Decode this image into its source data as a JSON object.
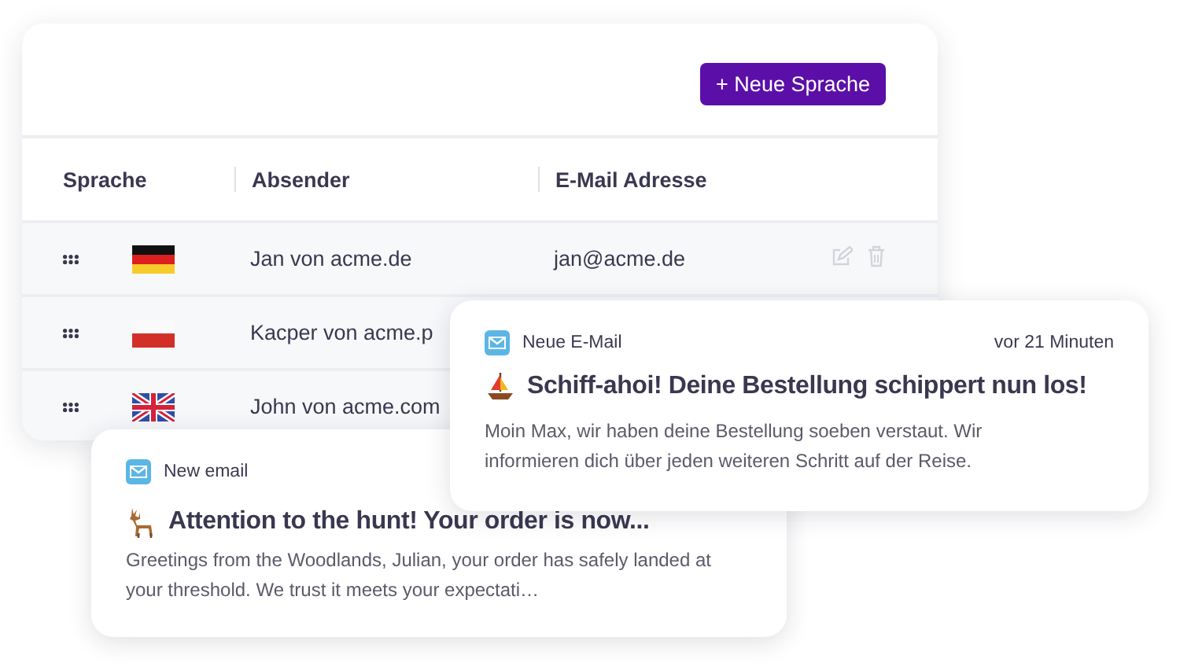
{
  "button": {
    "label": "+ Neue Sprache"
  },
  "table": {
    "columns": [
      "Sprache",
      "Absender",
      "E-Mail Adresse"
    ],
    "rows": [
      {
        "kind": "de",
        "sender": "Jan von acme.de",
        "email": "jan@acme.de"
      },
      {
        "kind": "pl",
        "sender": "Kacper von acme.p"
      },
      {
        "kind": "gb",
        "sender": "John von acme.com"
      }
    ]
  },
  "notifications": [
    {
      "app": "Neue E-Mail",
      "time": "vor 21 Minuten",
      "kind": "boat",
      "title": "Schiff-ahoi! Deine Bestellung schippert nun los!",
      "body": "Moin Max, wir haben deine Bestellung soeben verstaut. Wir informieren dich über jeden weiteren Schritt auf der Reise."
    },
    {
      "app": "New email",
      "kind": "deer",
      "title": "Attention to the hunt! Your order is now...",
      "body": "Greetings from the Woodlands, Julian, your order has safely landed at your threshold. We trust it meets your expectati…"
    }
  ]
}
